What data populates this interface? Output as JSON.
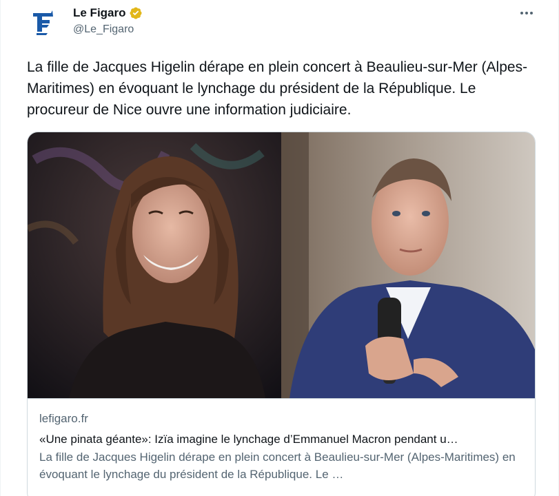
{
  "author": {
    "display_name": "Le Figaro",
    "handle": "@Le_Figaro",
    "avatar_icon": "le-figaro-logo",
    "verified_icon": "gold-verified-badge",
    "verified_color": "#E2B719"
  },
  "more_icon": "more-options-icon",
  "tweet": {
    "text": "La fille de Jacques Higelin dérape en plein concert à Beaulieu-sur-Mer (Alpes-Maritimes) en évoquant le lynchage du président de la République. Le procureur de Nice ouvre une information judiciaire."
  },
  "card": {
    "domain": "lefigaro.fr",
    "title": "«Une pinata géante»: Izïa imagine le lynchage d’Emmanuel Macron pendant u…",
    "description": "La fille de Jacques Higelin dérape en plein concert à Beaulieu-sur-Mer (Alpes-Maritimes) en évoquant le lynchage du président de la République. Le …"
  },
  "colors": {
    "text_primary": "#0f1419",
    "text_secondary": "#536471",
    "border": "#cfd9de",
    "figaro_blue": "#1a5aa8"
  }
}
